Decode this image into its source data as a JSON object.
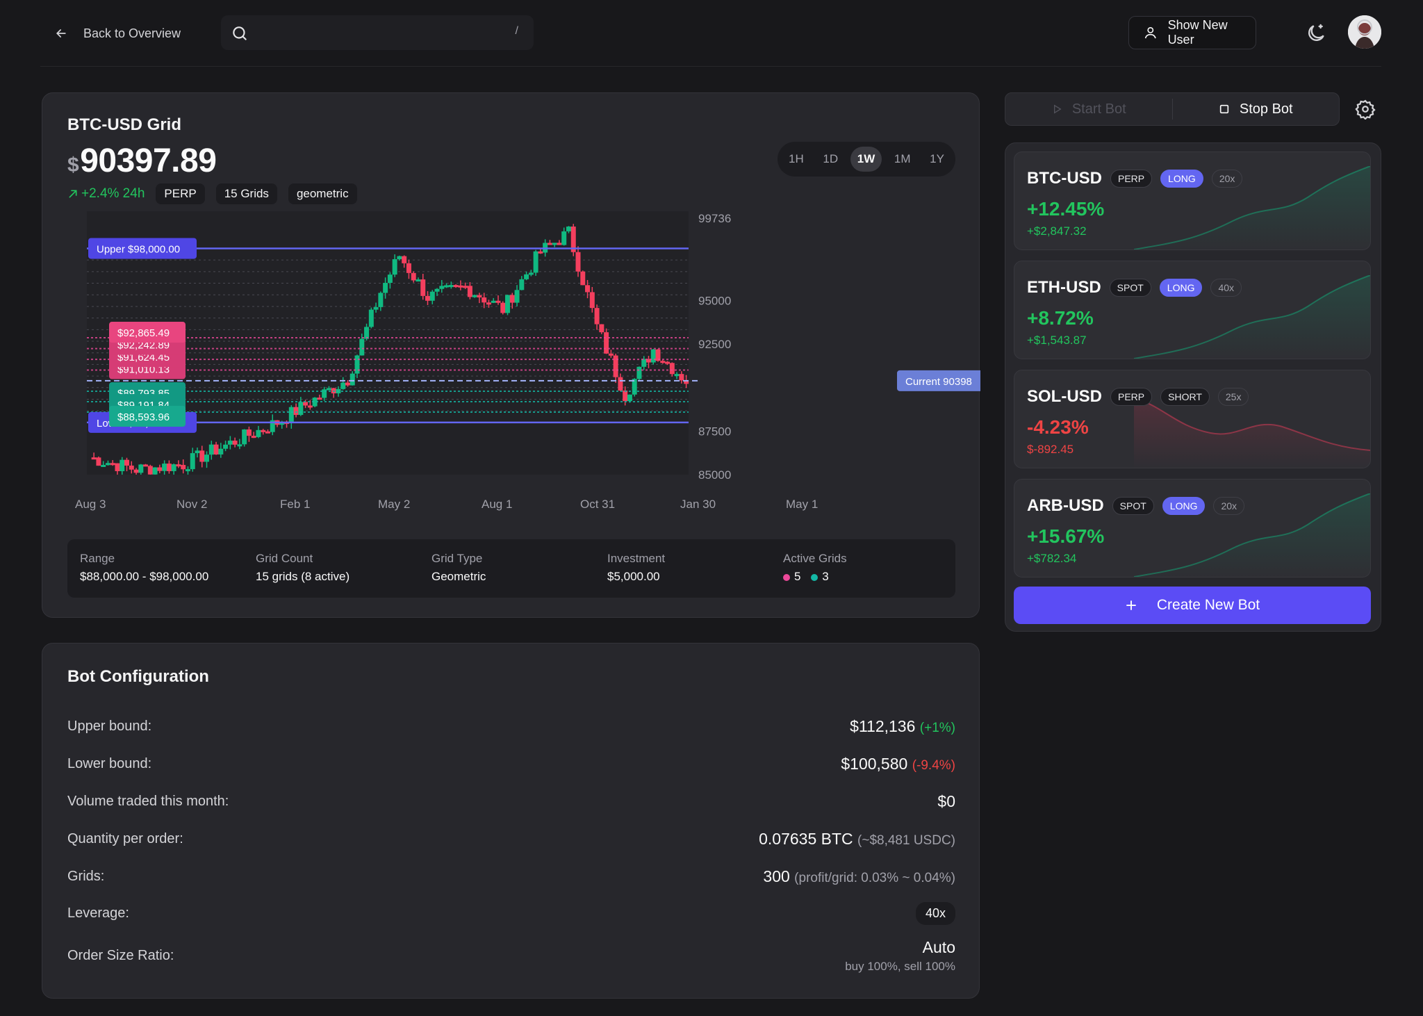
{
  "header": {
    "back_label": "Back to Overview",
    "search_placeholder": "",
    "search_shortcut": "/",
    "user_button_label": "Show New User"
  },
  "chart_card": {
    "title": "BTC-USD Grid",
    "currency_symbol": "$",
    "price": "90397.89",
    "change": "+2.4% 24h",
    "tags": [
      "PERP",
      "15 Grids",
      "geometric"
    ],
    "timeframes": [
      "1H",
      "1D",
      "1W",
      "1M",
      "1Y"
    ],
    "active_timeframe": "1W",
    "stats": {
      "range_label": "Range",
      "range_value": "$88,000.00 - $98,000.00",
      "count_label": "Grid Count",
      "count_value": "15 grids (8 active)",
      "type_label": "Grid Type",
      "type_value": "Geometric",
      "invest_label": "Investment",
      "invest_value": "$5,000.00",
      "active_label": "Active Grids",
      "active_sell": "5",
      "active_buy": "3"
    }
  },
  "chart_data": {
    "type": "candlestick",
    "y_ticks": [
      "99736",
      "95000",
      "92500",
      "87500",
      "85000"
    ],
    "y_tick_values": [
      99736,
      95000,
      92500,
      87500,
      85000
    ],
    "x_ticks": [
      "Aug 3",
      "Nov 2",
      "Feb 1",
      "May 2",
      "Aug 1",
      "Oct 31",
      "Jan 30",
      "May 1"
    ],
    "upper_label": "Upper $98,000.00",
    "upper_value": 98000,
    "lower_label": "Lower $88,000.00",
    "lower_value": 88000,
    "current_label": "Current 90398",
    "current_value": 90398,
    "sell_orders": [
      "$92,865.49",
      "$92,242.89",
      "$91,624.45",
      "$91,010.13"
    ],
    "buy_orders": [
      "$89,793.85",
      "$89,191.84",
      "$88,593.96"
    ],
    "colors": {
      "up": "#10b981",
      "down": "#f43f5e",
      "grid_line": "#6366f1",
      "sell": "#ec4899",
      "buy": "#14b8a6"
    }
  },
  "config": {
    "title": "Bot Configuration",
    "upper_key": "Upper bound:",
    "upper_val": "$112,136",
    "upper_sub": "(+1%)",
    "lower_key": "Lower bound:",
    "lower_val": "$100,580",
    "lower_sub": "(-9.4%)",
    "volume_key": "Volume traded this month:",
    "volume_val": "$0",
    "qty_key": "Quantity per order:",
    "qty_val": "0.07635 BTC",
    "qty_sub": "(~$8,481 USDC)",
    "grids_key": "Grids:",
    "grids_val": "300",
    "grids_sub": "(profit/grid: 0.03% ~ 0.04%)",
    "lev_key": "Leverage:",
    "lev_val": "40x",
    "ratio_key": "Order Size Ratio:",
    "ratio_val": "Auto",
    "ratio_sub": "buy 100%, sell 100%"
  },
  "controls": {
    "start_label": "Start Bot",
    "stop_label": "Stop Bot"
  },
  "bots": [
    {
      "symbol": "BTC-USD",
      "market": "PERP",
      "side": "LONG",
      "leverage": "20x",
      "pct": "+12.45%",
      "usd": "+$2,847.32",
      "positive": true
    },
    {
      "symbol": "ETH-USD",
      "market": "SPOT",
      "side": "LONG",
      "leverage": "40x",
      "pct": "+8.72%",
      "usd": "+$1,543.87",
      "positive": true
    },
    {
      "symbol": "SOL-USD",
      "market": "PERP",
      "side": "SHORT",
      "leverage": "25x",
      "pct": "-4.23%",
      "usd": "$-892.45",
      "positive": false
    },
    {
      "symbol": "ARB-USD",
      "market": "SPOT",
      "side": "LONG",
      "leverage": "20x",
      "pct": "+15.67%",
      "usd": "+$782.34",
      "positive": true
    }
  ],
  "create_label": "Create New Bot"
}
